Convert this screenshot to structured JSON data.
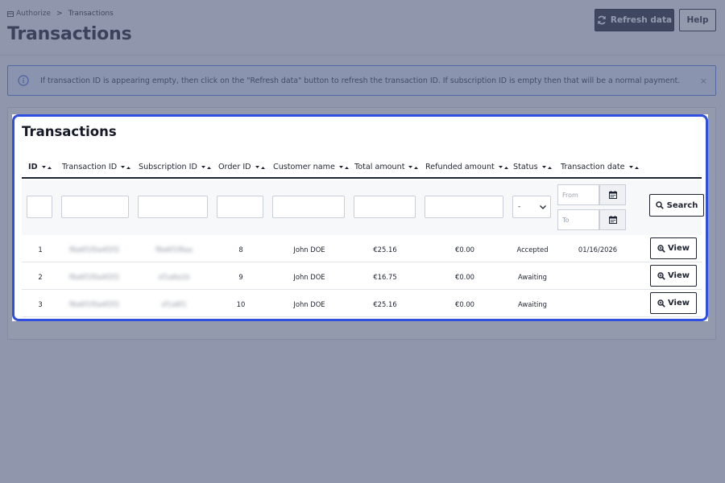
{
  "breadcrumb": {
    "root": "Authorize",
    "separator": ">",
    "current": "Transactions"
  },
  "header": {
    "title": "Transactions",
    "refresh_label": "Refresh data",
    "help_label": "Help"
  },
  "alert": {
    "text": "If transaction ID is appearing empty, then click on the \"Refresh data\" button to refresh the transaction ID. If subscription ID is empty then that will be a normal payment.",
    "close": "×"
  },
  "card": {
    "title": "Transactions"
  },
  "columns": [
    "ID",
    "Transaction ID",
    "Subscription ID",
    "Order ID",
    "Customer name",
    "Total amount",
    "Refunded amount",
    "Status",
    "Transaction date"
  ],
  "filters": {
    "status_value": "-",
    "date_from_placeholder": "From",
    "date_to_placeholder": "To",
    "search_label": "Search"
  },
  "rows": [
    {
      "id": "1",
      "transaction_id": "f8a6f1f0a4f2f2",
      "subscription_id": "f8a6f1f8aa",
      "order_id": "8",
      "customer": "John DOE",
      "total": "€25.16",
      "refunded": "€0.00",
      "status": "Accepted",
      "date": "01/16/2026",
      "action": "View"
    },
    {
      "id": "2",
      "transaction_id": "f8a6f1f0a4f2f2",
      "subscription_id": "sf1a6a1b",
      "order_id": "9",
      "customer": "John DOE",
      "total": "€16.75",
      "refunded": "€0.00",
      "status": "Awaiting",
      "date": "",
      "action": "View"
    },
    {
      "id": "3",
      "transaction_id": "f8a6f1f0a4f2f2",
      "subscription_id": "sf1a6f1",
      "order_id": "10",
      "customer": "John DOE",
      "total": "€25.16",
      "refunded": "€0.00",
      "status": "Awaiting",
      "date": "",
      "action": "View"
    }
  ],
  "colors": {
    "primary_dark": "#1d2433",
    "accent_blue": "#2f4fe0",
    "alert_bg": "#e8f0fe",
    "overlay": "#535c7d"
  },
  "icons": {
    "refresh": "refresh-icon",
    "info": "info-icon",
    "calendar": "calendar-icon",
    "search": "search-icon",
    "view": "zoom-in-icon"
  }
}
